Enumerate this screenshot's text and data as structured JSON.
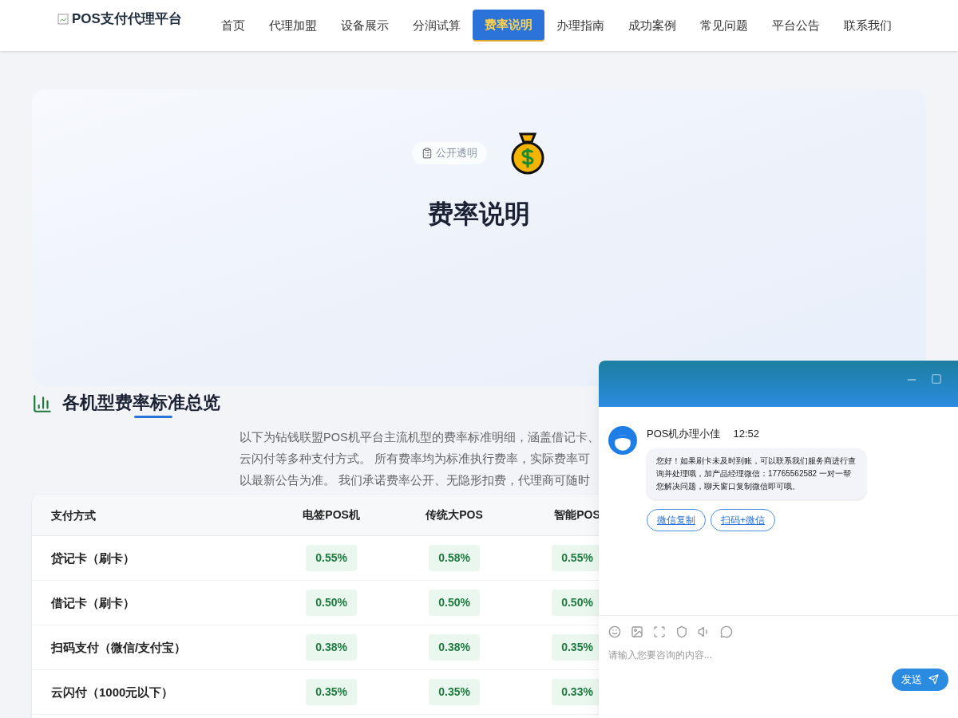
{
  "logo": {
    "text": "POS支付代理平台"
  },
  "nav": [
    {
      "label": "首页",
      "selected": false
    },
    {
      "label": "代理加盟",
      "selected": false
    },
    {
      "label": "设备展示",
      "selected": false
    },
    {
      "label": "分润试算",
      "selected": false
    },
    {
      "label": "费率说明",
      "selected": true
    },
    {
      "label": "办理指南",
      "selected": false
    },
    {
      "label": "成功案例",
      "selected": false
    },
    {
      "label": "常见问题",
      "selected": false
    },
    {
      "label": "平台公告",
      "selected": false
    },
    {
      "label": "联系我们",
      "selected": false
    }
  ],
  "hero": {
    "badge": "公开透明",
    "title": "费率说明"
  },
  "section": {
    "title": "各机型费率标准总览",
    "intro": [
      "以下为钻钱联盟POS机平台主流机型的费率标准明细，涵盖借记卡、",
      "云闪付等多种支付方式。 所有费率均为标准执行费率，实际费率可",
      "以最新公告为准。 我们承诺费率公开、无隐形扣费，代理商可随时"
    ]
  },
  "table": {
    "columns": [
      "支付方式",
      "电签POS机",
      "传统大POS",
      "智能POS"
    ],
    "rows": [
      [
        "贷记卡（刷卡）",
        "0.55%",
        "0.58%",
        "0.55%"
      ],
      [
        "借记卡（刷卡）",
        "0.50%",
        "0.50%",
        "0.50%"
      ],
      [
        "扫码支付（微信/支付宝）",
        "0.38%",
        "0.38%",
        "0.35%"
      ],
      [
        "云闪付（1000元以下）",
        "0.35%",
        "0.35%",
        "0.33%"
      ]
    ]
  },
  "chat": {
    "sender": "POS机办理小佳",
    "time": "12:52",
    "message": "您好！如果刷卡未及时到账，可以联系我们服务商进行查询并处理哦，加产品经理微信：17765562582 一对一帮您解决问题，聊天窗口复制微信即可哦。",
    "actions": [
      "微信复制",
      "扫码+微信"
    ],
    "input": {
      "placeholder": "请输入您要咨询的内容..."
    },
    "send": "发送"
  }
}
